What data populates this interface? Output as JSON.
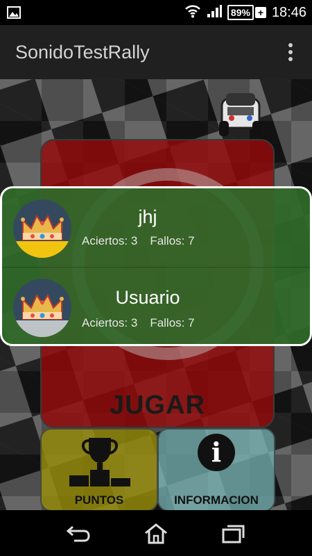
{
  "status_bar": {
    "battery_percent": "89%",
    "charging_label": "+",
    "time": "18:46",
    "icons": [
      "image-notification-icon",
      "wifi-icon",
      "signal-icon",
      "battery-icon"
    ]
  },
  "action_bar": {
    "title": "SonidoTestRally",
    "overflow_icon": "overflow-menu-icon"
  },
  "main": {
    "play_label": "JUGAR",
    "puntos_label": "PUNTOS",
    "info_label": "INFORMACION",
    "colors": {
      "play": "#960a0a",
      "puntos": "#968c0a",
      "info": "#78b4b4"
    }
  },
  "dialog": {
    "background": "#30692a",
    "users": [
      {
        "name": "jhj",
        "aciertos": "Aciertos: 3",
        "fallos": "Fallos: 7",
        "crown_base": "#f1c40f"
      },
      {
        "name": "Usuario",
        "aciertos": "Aciertos: 3",
        "fallos": "Fallos: 7",
        "crown_base": "#bdc3c7"
      }
    ]
  },
  "nav_bar": {
    "icons": [
      "back-icon",
      "home-icon",
      "recent-apps-icon"
    ]
  }
}
